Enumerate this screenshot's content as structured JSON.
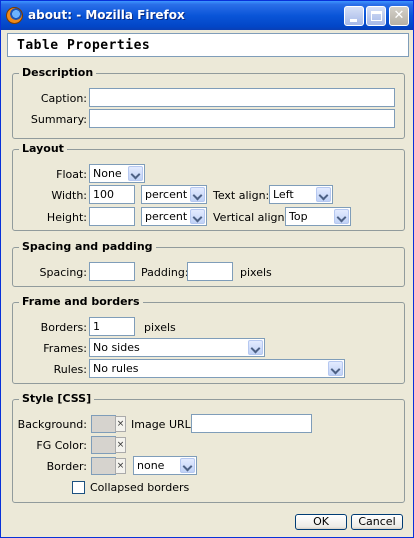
{
  "window": {
    "title": "about: - Mozilla Firefox"
  },
  "header": {
    "title": "Table Properties"
  },
  "description": {
    "legend": "Description",
    "caption_label": "Caption:",
    "caption_value": "",
    "summary_label": "Summary:",
    "summary_value": ""
  },
  "layout": {
    "legend": "Layout",
    "float_label": "Float:",
    "float_value": "None",
    "width_label": "Width:",
    "width_value": "100",
    "width_unit": "percent",
    "text_align_label": "Text align:",
    "text_align_value": "Left",
    "height_label": "Height:",
    "height_value": "",
    "height_unit": "percent",
    "vertical_align_label": "Vertical align:",
    "vertical_align_value": "Top"
  },
  "spacing": {
    "legend": "Spacing and padding",
    "spacing_label": "Spacing:",
    "spacing_value": "",
    "padding_label": "Padding:",
    "padding_value": "",
    "unit": "pixels"
  },
  "frame": {
    "legend": "Frame and borders",
    "borders_label": "Borders:",
    "borders_value": "1",
    "borders_unit": "pixels",
    "frames_label": "Frames:",
    "frames_value": "No sides",
    "rules_label": "Rules:",
    "rules_value": "No rules"
  },
  "style": {
    "legend": "Style [CSS]",
    "background_label": "Background:",
    "image_url_label": "Image URL:",
    "image_url_value": "",
    "fg_color_label": "FG Color:",
    "border_label": "Border:",
    "border_style_value": "none",
    "collapsed_label": "Collapsed borders",
    "collapsed_checked": false,
    "clear_glyph": "×"
  },
  "buttons": {
    "ok": "OK",
    "cancel": "Cancel"
  },
  "colors": {
    "titlebar": "#0a55d8",
    "dialog_bg": "#ece9d8",
    "field_border": "#7f9db9"
  }
}
